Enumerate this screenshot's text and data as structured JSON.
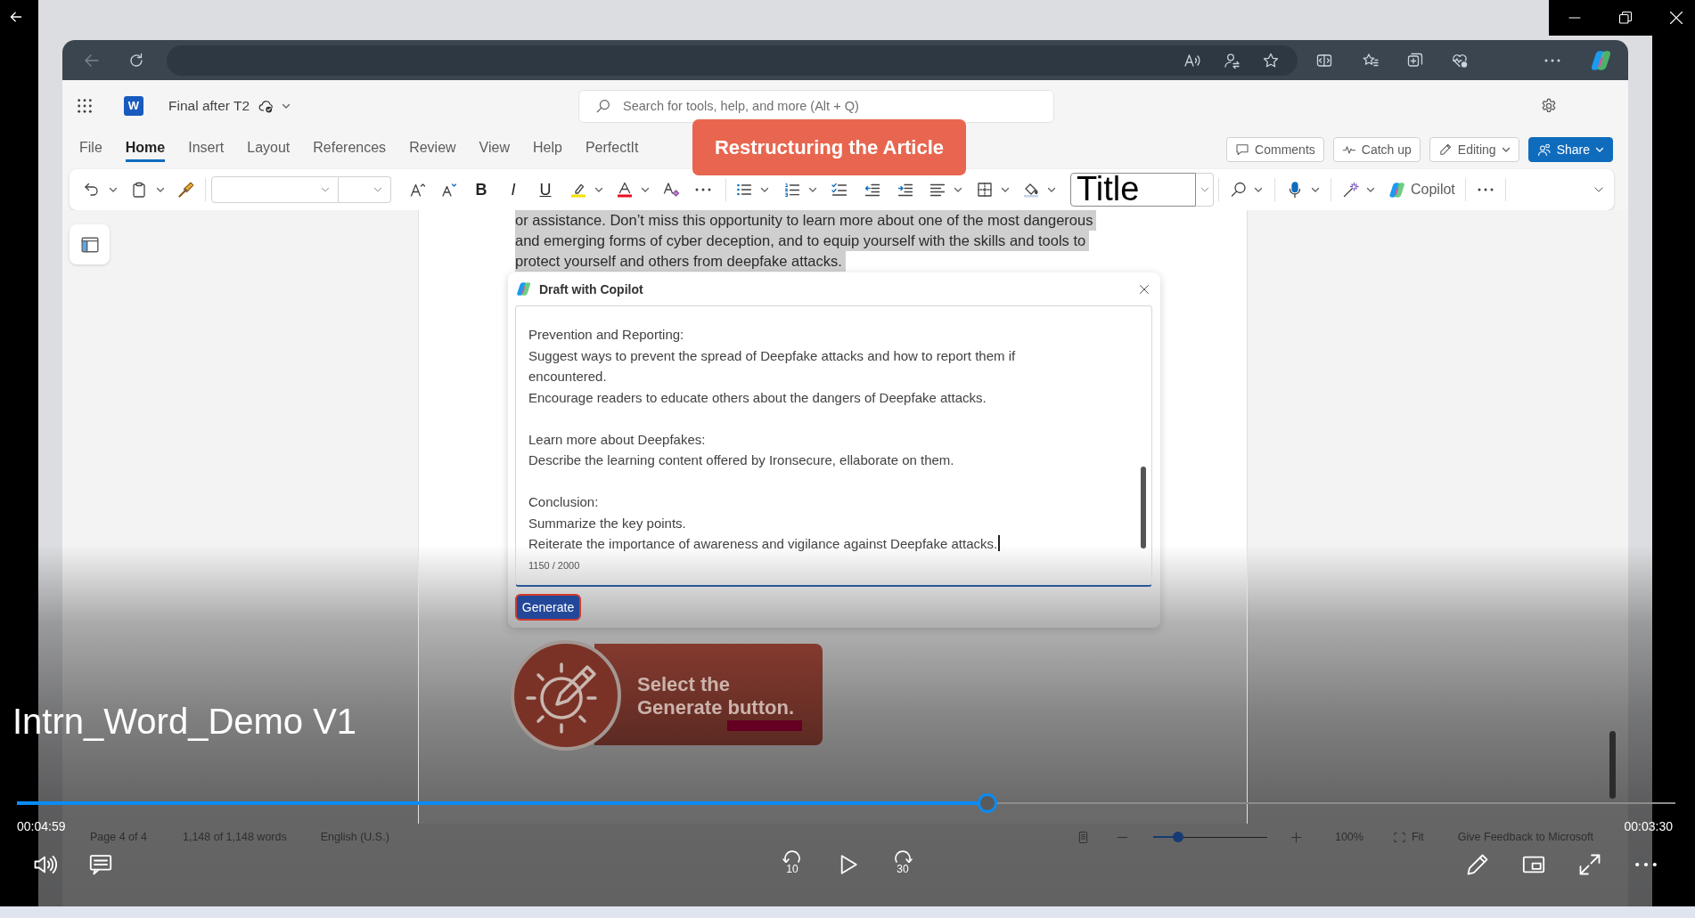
{
  "player": {
    "title": "Intrn_Word_Demo V1",
    "elapsed": "00:04:59",
    "remaining": "00:03:30",
    "progress": {
      "level": 0.585
    },
    "skip_back": "10",
    "skip_forward": "30"
  },
  "word": {
    "logo": "W",
    "doc_title": "Final after T2",
    "search": {
      "placeholder": "Search for tools, help, and more (Alt + Q)"
    },
    "tabs": [
      {
        "label": "File",
        "selected": false
      },
      {
        "label": "Home",
        "selected": true
      },
      {
        "label": "Insert",
        "selected": false
      },
      {
        "label": "Layout",
        "selected": false
      },
      {
        "label": "References",
        "selected": false
      },
      {
        "label": "Review",
        "selected": false
      },
      {
        "label": "View",
        "selected": false
      },
      {
        "label": "Help",
        "selected": false
      },
      {
        "label": "PerfectIt",
        "selected": false
      }
    ],
    "actions": [
      {
        "kind": "comments",
        "label": "Comments"
      },
      {
        "kind": "catch-up",
        "label": "Catch up"
      },
      {
        "kind": "editing",
        "label": "Editing"
      },
      {
        "kind": "share",
        "label": "Share"
      }
    ],
    "ribbon": {
      "format": [
        {
          "kind": "bold",
          "label": "B"
        },
        {
          "kind": "italic",
          "label": "I"
        },
        {
          "kind": "underline",
          "label": "U"
        }
      ],
      "style": "Title",
      "copilot": "Copilot"
    },
    "document": {
      "selected": true,
      "lines": [
        "or assistance. Don’t miss this opportunity to learn more about one of the most dangerous",
        "and emerging forms of cyber deception, and to equip yourself with the skills and tools to",
        "protect yourself and others from deepfake attacks."
      ]
    },
    "status_bar": {
      "page": "Page 4 of 4",
      "words": "1,148 of 1,148 words",
      "language": "English (U.S.)",
      "zoom": {
        "level": 0.22
      },
      "zoom_percent": "100%",
      "fit": "Fit",
      "feedback": "Give Feedback to Microsoft"
    }
  },
  "copilot_dialog": {
    "title": "Draft with Copilot",
    "sections": [
      {
        "lines": [
          "Prevention and Reporting:",
          "Suggest ways to prevent the spread of Deepfake attacks and how to report them if encountered.",
          "Encourage readers to educate others about the dangers of Deepfake attacks."
        ]
      },
      {
        "lines": [
          "Learn more about Deepfakes:",
          "Describe the learning content offered by Ironsecure, ellaborate on them."
        ]
      },
      {
        "lines": [
          "Conclusion:",
          "Summarize the key points.",
          "Reiterate the importance of awareness and vigilance against Deepfake attacks."
        ]
      }
    ],
    "counter": "1150 / 2000",
    "button": "Generate"
  },
  "annotations": [
    {
      "kind": "banner",
      "text": "Restructuring the Article"
    },
    {
      "kind": "tip",
      "text": "Select the Generate button."
    }
  ]
}
